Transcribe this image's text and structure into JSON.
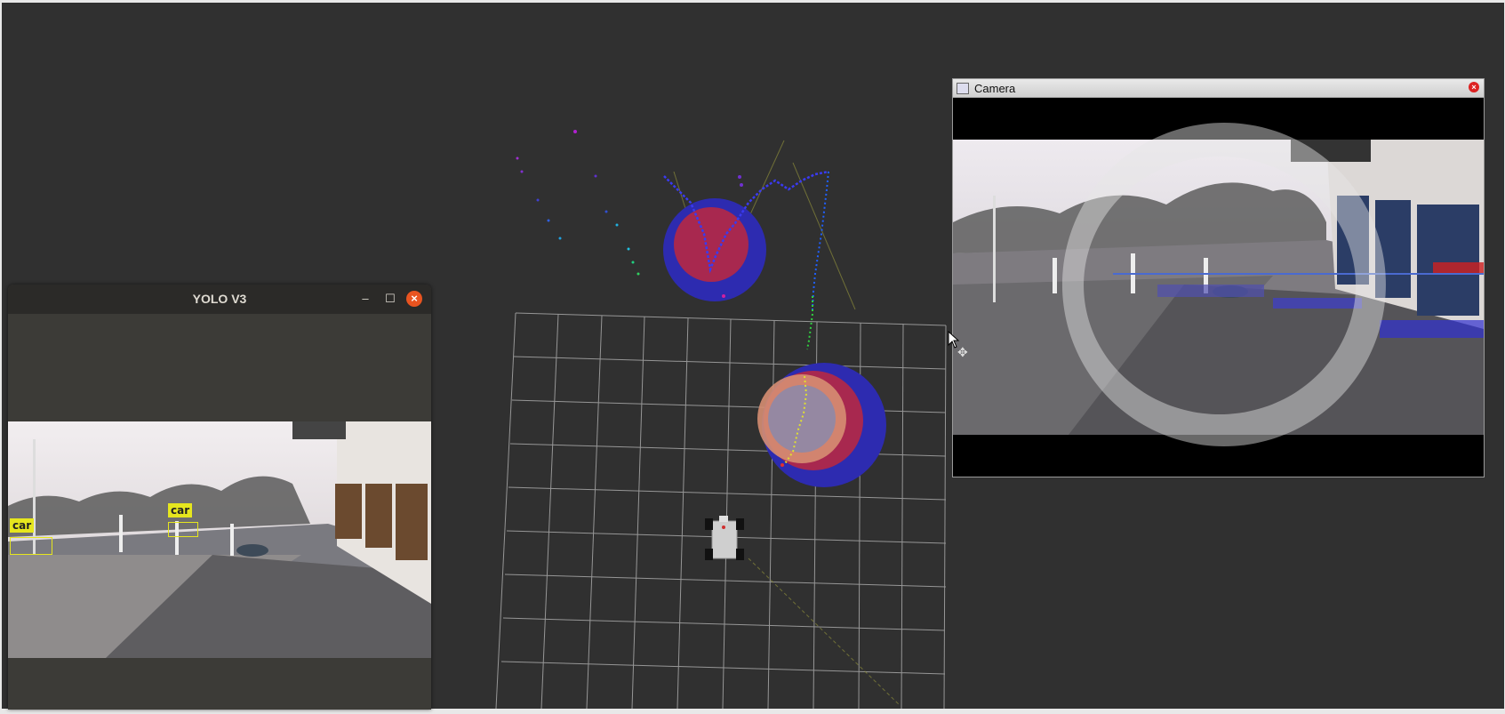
{
  "yolo_window": {
    "title": "YOLO V3",
    "minimize_label": "–",
    "maximize_label": "☐",
    "close_label": "×",
    "detections": [
      {
        "label": "car"
      },
      {
        "label": "car"
      }
    ]
  },
  "camera_window": {
    "title": "Camera",
    "close_label": "×"
  },
  "colors": {
    "viewport_bg": "#303030",
    "grid": "#a8a8a8",
    "detection": "#e6e61e",
    "accent_close": "#e95420"
  },
  "icons": [
    "app-icon",
    "close-icon",
    "minimize-icon",
    "maximize-icon",
    "mouse-pointer-icon",
    "move-cursor-icon"
  ]
}
